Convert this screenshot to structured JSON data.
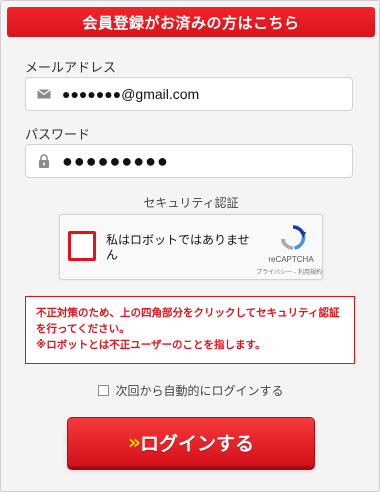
{
  "header": {
    "title": "会員登録がお済みの方はこちら"
  },
  "email": {
    "label": "メールアドレス",
    "value": "●●●●●●●@gmail.com",
    "icon": "envelope-icon"
  },
  "password": {
    "label": "パスワード",
    "value": "●●●●●●●●●",
    "icon": "lock-icon"
  },
  "captcha": {
    "section_label": "セキュリティ認証",
    "checkbox_label": "私はロボットではありません",
    "brand": "reCAPTCHA",
    "links": "プライバシー - 利用規約"
  },
  "warning": {
    "line1": "不正対策のため、上の四角部分をクリックしてセキュリティ認証",
    "line2": "を行ってください。",
    "line3": "※ロボットとは不正ユーザーのことを指します。"
  },
  "auto_login": {
    "label": "次回から自動的にログインする",
    "checked": false
  },
  "login_button": {
    "chevron": "»",
    "label": "ログインする"
  },
  "colors": {
    "accent_red": "#e1121a",
    "chevron_yellow": "#ffd400"
  }
}
